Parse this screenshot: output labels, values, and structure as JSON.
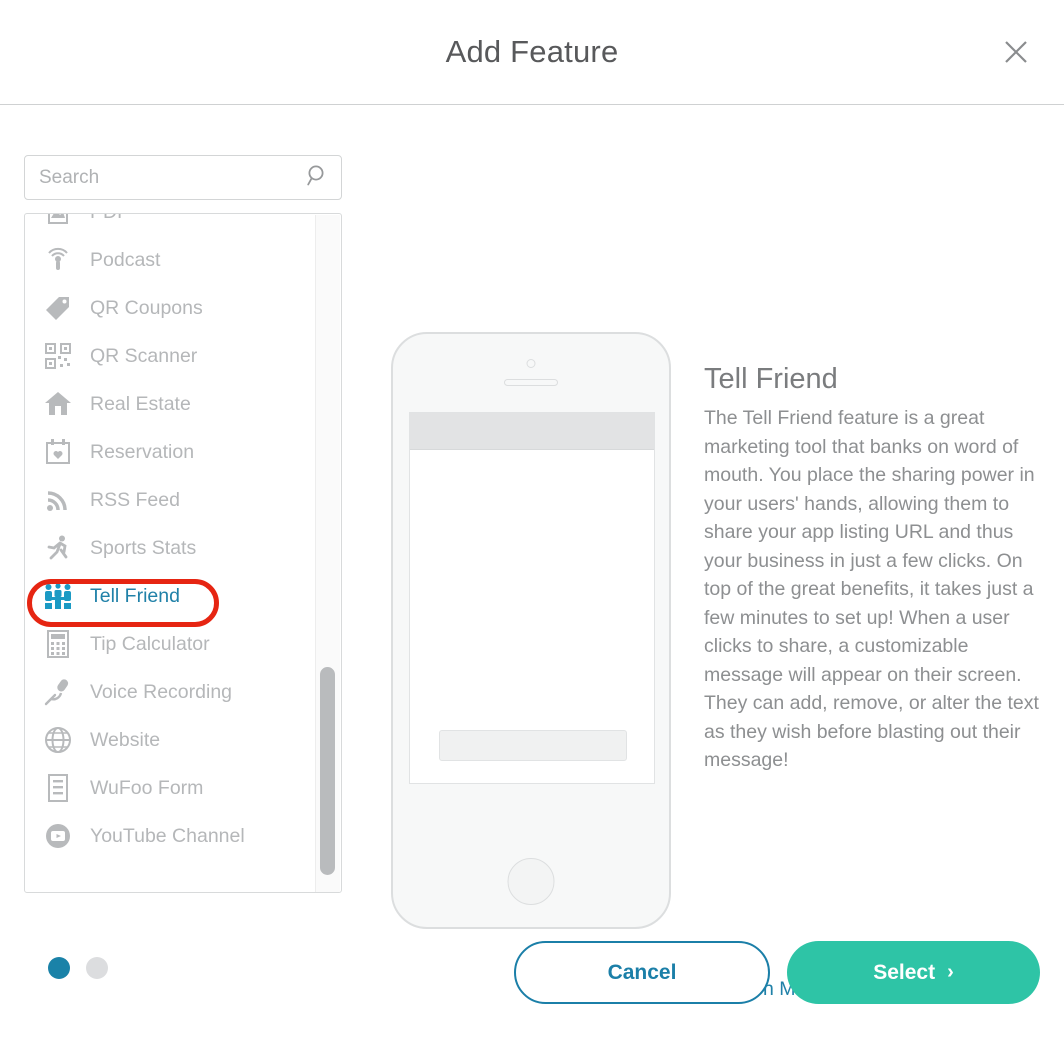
{
  "header": {
    "title": "Add Feature",
    "close_label": "Close"
  },
  "search": {
    "placeholder": "Search",
    "value": ""
  },
  "feature_list": {
    "items": [
      {
        "label": "PDF",
        "icon": "pdf-icon",
        "selected": false
      },
      {
        "label": "Podcast",
        "icon": "podcast-icon",
        "selected": false
      },
      {
        "label": "QR Coupons",
        "icon": "tag-icon",
        "selected": false
      },
      {
        "label": "QR Scanner",
        "icon": "qr-code-icon",
        "selected": false
      },
      {
        "label": "Real Estate",
        "icon": "house-icon",
        "selected": false
      },
      {
        "label": "Reservation",
        "icon": "calendar-heart-icon",
        "selected": false
      },
      {
        "label": "RSS Feed",
        "icon": "rss-icon",
        "selected": false
      },
      {
        "label": "Sports Stats",
        "icon": "runner-icon",
        "selected": false
      },
      {
        "label": "Tell Friend",
        "icon": "tell-friend-icon",
        "selected": true
      },
      {
        "label": "Tip Calculator",
        "icon": "calculator-icon",
        "selected": false
      },
      {
        "label": "Voice Recording",
        "icon": "microphone-icon",
        "selected": false
      },
      {
        "label": "Website",
        "icon": "globe-icon",
        "selected": false
      },
      {
        "label": "WuFoo Form",
        "icon": "form-icon",
        "selected": false
      },
      {
        "label": "YouTube Channel",
        "icon": "youtube-icon",
        "selected": false
      }
    ]
  },
  "detail": {
    "title": "Tell Friend",
    "description": "The Tell Friend feature is a great marketing tool that banks on word of mouth. You place the sharing power in your users' hands, allowing them to share your app listing URL and thus your business in just a few clicks. On top of the great benefits, it takes just a few minutes to set up! When a user clicks to share, a customizable message will appear on their screen. They can add, remove, or alter the text as they wish before blasting out their message!",
    "learn_more_label": "Learn More"
  },
  "pagination": {
    "total": 2,
    "active_index": 0
  },
  "footer": {
    "cancel_label": "Cancel",
    "select_label": "Select",
    "select_chevron": "›"
  },
  "colors": {
    "accent_teal": "#2ec4a6",
    "accent_blue": "#1b7fa8",
    "link_blue": "#2081a8",
    "annotation_red": "#e62512",
    "text_gray": "#8d8f91",
    "title_gray": "#58595b"
  }
}
